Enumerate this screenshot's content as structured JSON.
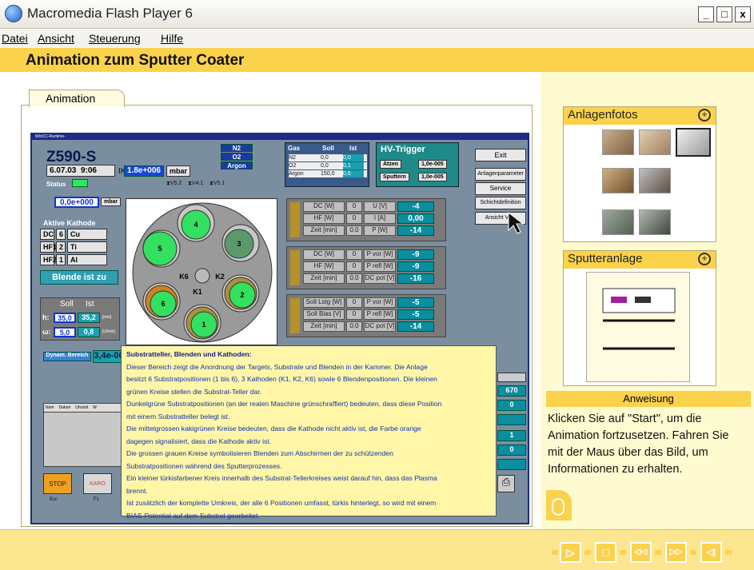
{
  "window": {
    "title": "Macromedia Flash Player 6",
    "min": "_",
    "max": "□",
    "close": "x"
  },
  "menu": [
    "Datei",
    "Ansicht",
    "Steuerung",
    "Hilfe"
  ],
  "header": {
    "title": "Animation zum Sputter Coater"
  },
  "tab": {
    "label": "Animation"
  },
  "scada": {
    "bar_title": "WinCC-Runtime-",
    "machine": "Z590-S",
    "date": "6.07.03",
    "time": "9:06",
    "ikr_label": "IKR",
    "ikr_value": "1.8e+006",
    "ikr_unit": "mbar",
    "status_label": "Status",
    "pressure_value": "0,0e+000",
    "pressure_unit": "mbar",
    "gas_lines": [
      "N2",
      "O2",
      "Argon"
    ],
    "valves": [
      "V5.2",
      "V4.1",
      "V5.1"
    ],
    "gas_table": {
      "headers": [
        "Gas",
        "Soll",
        "Ist"
      ],
      "rows": [
        [
          "N2",
          "0,0",
          "0,0"
        ],
        [
          "O2",
          "0,0",
          "0,1"
        ],
        [
          "Argon",
          "150,0",
          "0,6"
        ]
      ]
    },
    "hv_trigger": {
      "title": "HV-Trigger",
      "rows": [
        [
          "Ätzen",
          "1,0e-005"
        ],
        [
          "Sputtern",
          "1,0e-005"
        ]
      ]
    },
    "buttons": [
      "Exit",
      "Anlagenparameter",
      "Service",
      "Schichtdefinition",
      "Ansicht Va..."
    ],
    "kathode_title": "Aktive Kathode",
    "kathodes": [
      [
        "DC",
        "6",
        "Cu"
      ],
      [
        "HF1",
        "2",
        "Ti"
      ],
      [
        "HF2",
        "1",
        "Al"
      ]
    ],
    "blende": "Blende ist zu",
    "soll_ist": {
      "soll": "Soll",
      "ist": "Ist",
      "h_label": "h:",
      "h_soll": "35,0",
      "h_ist": "35,2",
      "h_unit": "[mm]",
      "w_label": "ω:",
      "w_soll": "5,0",
      "w_ist": "0,8",
      "w_unit": "[U/min]"
    },
    "dynam_label": "Dynam. Bereich",
    "dynam_value": "3,4e-00",
    "log_headers": [
      "Num",
      "Datum",
      "Uhrzeit",
      "W"
    ],
    "fkeys": [
      [
        "STOP",
        "Esc"
      ],
      [
        "KARO",
        "F1"
      ]
    ],
    "plate_labels": [
      "1",
      "2",
      "3",
      "4",
      "5",
      "6",
      "K1",
      "K2",
      "K6"
    ],
    "dc_panel": {
      "rows": [
        [
          "DC [W]",
          "0",
          "U [V]",
          "-4"
        ],
        [
          "HF [W]",
          "0",
          "I [A]",
          "0,00"
        ],
        [
          "Zeit [min]",
          "0,0",
          "P [W]",
          "-14"
        ]
      ]
    },
    "hf_panel": {
      "rows": [
        [
          "DC [W]",
          "0",
          "P vor [W]",
          "-9"
        ],
        [
          "HF [W]",
          "0",
          "P refl [W]",
          "-9"
        ],
        [
          "Zeit [min]",
          "0,0",
          "DC pot [V]",
          "-16"
        ]
      ]
    },
    "bias_panel": {
      "rows": [
        [
          "Soll Lstg [W]",
          "0",
          "P vor [W]",
          "-5"
        ],
        [
          "Soll Bias [V]",
          "0",
          "P refl [W]",
          "-5"
        ],
        [
          "Zeit [min]",
          "0,0",
          "DC pot [V]",
          "-14"
        ]
      ]
    },
    "right_values": [
      "670",
      "0",
      "1",
      "0"
    ]
  },
  "tooltip": {
    "title": "Substratteller, Blenden und Kathoden:",
    "lines": [
      "Dieser Bereich zeigt die Anordnung der Targets, Substrate und Blenden in der Kammer. Die Anlage",
      "besitzt 6 Substratpositionen (1 bis 6), 3 Kathoden (K1, K2, K6) sowie 6 Blendenpositionen. Die kleinen",
      "grünen Kreise stellen die Substrat-Teller dar.",
      "Dunkelgrüne Substratpositionen (an der realen Maschine grünschraffiert) bedeuten, dass diese Position",
      "mit einem Substratteller belegt ist.",
      "Die mittelgrossen kakigrünen Kreise bedeuten, dass die Kathode nicht aktiv ist, die Farbe orange",
      "dagegen signalisiert, dass die Kathode aktiv ist.",
      "Die grossen grauen Kreise symbolisieren Blenden zum Abschirmen der zu schützenden",
      "Substratpositionen während des Sputterprozesses.",
      "Ein kleiner türkisfarbener Kreis innerhalb des Substrat-Tellerkreises weist darauf hin, dass das Plasma",
      "brennt.",
      "Ist zusätzlich der komplette Umkreis, der alle 6 Positionen umfasst, türkis hinterlegt, so wird mit einem",
      "BIAS-Potential auf dem Substrat gearbeitet."
    ]
  },
  "right": {
    "photos_title": "Anlagenfotos",
    "photos_zoom": "⊕",
    "sputter_title": "Sputteranlage",
    "sputter_zoom": "⊕",
    "instr_title": "Anweisung",
    "instr_text": "Klicken Sie auf \"Start\", um die Animation fortzusetzen. Fahren Sie mit der Maus über das Bild, um Informationen zu erhalten."
  },
  "nav": [
    "▷",
    "□",
    "◁◁",
    "▷▷",
    "◁|"
  ]
}
